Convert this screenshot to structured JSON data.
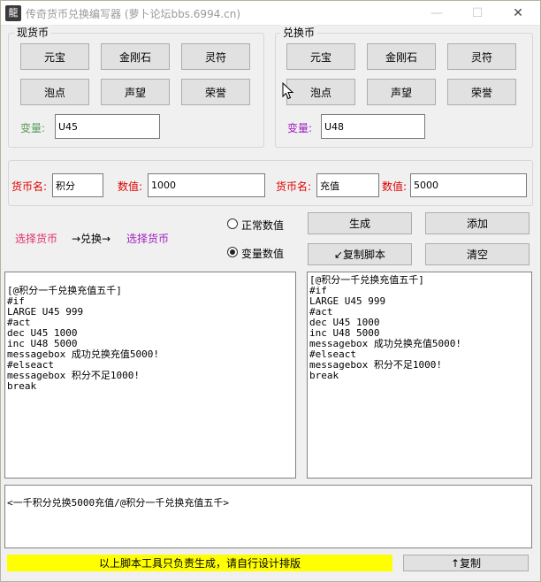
{
  "window": {
    "title": "传奇货币兑换编写器 (萝卜论坛bbs.6994.cn)",
    "icon_glyph": "龍",
    "minimize_glyph": "—",
    "maximize_glyph": "☐",
    "close_glyph": "✕"
  },
  "current_currency": {
    "title": "现货币",
    "buttons": [
      "元宝",
      "金刚石",
      "灵符",
      "泡点",
      "声望",
      "荣誉"
    ],
    "var_label": "变量:",
    "var_value": "U45",
    "var_label_color": "#5a9a5a"
  },
  "exchange_currency": {
    "title": "兑换币",
    "buttons": [
      "元宝",
      "金刚石",
      "灵符",
      "泡点",
      "声望",
      "荣誉"
    ],
    "var_label": "变量:",
    "var_value": "U48",
    "var_label_color": "#a020c0"
  },
  "currency_names": {
    "left_name_label": "货币名:",
    "left_name_value": "积分",
    "left_amount_label": "数值:",
    "left_amount_value": "1000",
    "right_name_label": "货币名:",
    "right_name_value": "充值",
    "right_amount_label": "数值:",
    "right_amount_value": "5000",
    "label_color": "#e00000"
  },
  "flow": {
    "from": "选择货币",
    "arrow": "→兑换→",
    "to": "选择货币",
    "from_color": "#e0306a",
    "to_color": "#a020c0"
  },
  "mode": {
    "normal_label": "正常数值",
    "variable_label": "变量数值",
    "selected": "variable"
  },
  "actions": {
    "generate": "生成",
    "add": "添加",
    "copy_script": "↙复制脚本",
    "clear": "清空",
    "copy": "↑复制"
  },
  "editors": {
    "left": "\n[@积分一千兑换充值五千]\n#if\nLARGE U45 999\n#act\ndec U45 1000\ninc U48 5000\nmessagebox 成功兑换充值5000!\n#elseact\nmessagebox 积分不足1000!\nbreak",
    "right": "[@积分一千兑换充值五千]\n#if\nLARGE U45 999\n#act\ndec U45 1000\ninc U48 5000\nmessagebox 成功兑换充值5000!\n#elseact\nmessagebox 积分不足1000!\nbreak",
    "bottom": "<一千积分兑换5000充值/@积分一千兑换充值五千>"
  },
  "footer": {
    "notice": "以上脚本工具只负责生成，请自行设计排版",
    "notice_color": "#ffff00"
  }
}
